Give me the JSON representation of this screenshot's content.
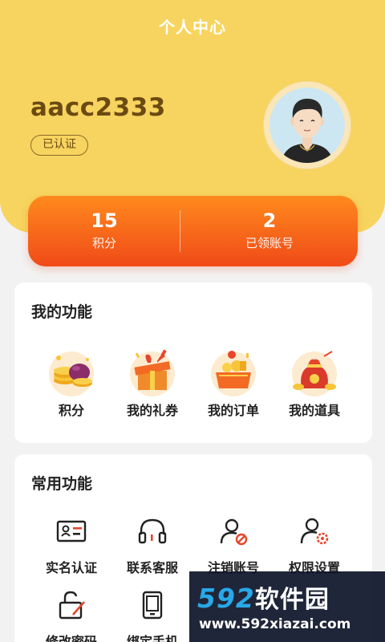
{
  "header": {
    "title": "个人中心",
    "background_color": "#f7d45f"
  },
  "profile": {
    "username": "aacc2333",
    "verified_label": "已认证",
    "avatar_icon": "avatar-icon"
  },
  "stats": {
    "items": [
      {
        "value": "15",
        "label": "积分"
      },
      {
        "value": "2",
        "label": "已领账号"
      }
    ],
    "gradient": [
      "#ff8a1d",
      "#f04a18"
    ]
  },
  "my_features": {
    "title": "我的功能",
    "items": [
      {
        "label": "积分",
        "icon": "coins-icon"
      },
      {
        "label": "我的礼券",
        "icon": "gift-box-icon"
      },
      {
        "label": "我的订单",
        "icon": "order-cart-icon"
      },
      {
        "label": "我的道具",
        "icon": "treasure-bag-icon"
      }
    ]
  },
  "common_features": {
    "title": "常用功能",
    "items": [
      {
        "label": "实名认证",
        "icon": "id-card-icon"
      },
      {
        "label": "联系客服",
        "icon": "headset-icon"
      },
      {
        "label": "注销账号",
        "icon": "user-cancel-icon"
      },
      {
        "label": "权限设置",
        "icon": "user-settings-icon"
      },
      {
        "label": "修改密码",
        "icon": "lock-edit-icon"
      },
      {
        "label": "绑定手机",
        "icon": "phone-icon"
      }
    ],
    "accent_color": "#e8452c"
  },
  "watermark": {
    "logo_number": "592",
    "logo_text": "软件园",
    "url": "www.592xiazai.com"
  }
}
